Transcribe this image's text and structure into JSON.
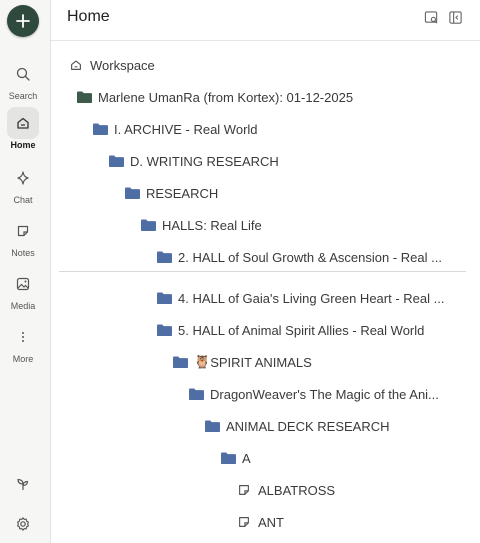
{
  "header": {
    "title": "Home"
  },
  "nav": {
    "search": "Search",
    "home": "Home",
    "chat": "Chat",
    "notes": "Notes",
    "media": "Media",
    "more": "More"
  },
  "colors": {
    "accent": "#2e4a3c",
    "folder_blue": "#4f6fa5",
    "folder_green": "#3d5a4a"
  },
  "tree": {
    "workspace": "Workspace",
    "items": [
      {
        "label": "Marlene UmanRa (from Kortex): 01-12-2025",
        "icon": "folder-dark-icon"
      },
      {
        "label": "I. ARCHIVE - Real World",
        "icon": "folder-icon"
      },
      {
        "label": "D. WRITING RESEARCH",
        "icon": "folder-icon"
      },
      {
        "label": "RESEARCH",
        "icon": "folder-icon"
      },
      {
        "label": "HALLS: Real Life",
        "icon": "folder-icon"
      },
      {
        "label": "2. HALL of Soul Growth & Ascension - Real ...",
        "icon": "folder-icon"
      },
      {
        "label": "4. HALL of Gaia's Living Green Heart - Real ...",
        "icon": "folder-icon"
      },
      {
        "label": "5. HALL of Animal Spirit Allies - Real World",
        "icon": "folder-icon"
      },
      {
        "label": "SPIRIT ANIMALS",
        "icon": "folder-icon",
        "emoji": "🦉"
      },
      {
        "label": "DragonWeaver's The Magic of the Ani...",
        "icon": "folder-icon"
      },
      {
        "label": "ANIMAL DECK RESEARCH",
        "icon": "folder-icon"
      },
      {
        "label": "A",
        "icon": "folder-icon"
      },
      {
        "label": "ALBATROSS",
        "icon": "note-icon"
      },
      {
        "label": "ANT",
        "icon": "note-icon"
      }
    ]
  }
}
